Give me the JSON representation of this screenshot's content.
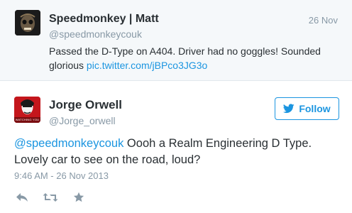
{
  "top_tweet": {
    "display_name": "Speedmonkey | Matt",
    "handle": "@speedmonkeycouk",
    "date": "26 Nov",
    "text": "Passed the D-Type on A404. Driver had no goggles!  Sounded glorious ",
    "link": "pic.twitter.com/jBPco3JG3o"
  },
  "main_tweet": {
    "display_name": "Jorge Orwell",
    "handle": "@Jorge_orwell",
    "mention": "@speedmonkeycouk",
    "text_after_mention": " Oooh  a Realm Engineering D Type. Lovely car to see on the road, loud?",
    "timestamp": "9:46 AM - 26 Nov 2013",
    "avatar_caption": "WATCHING YOU"
  },
  "follow_button": {
    "label": "Follow"
  },
  "actions": [
    "reply-icon",
    "retweet-icon",
    "favorite-icon"
  ],
  "colors": {
    "link": "#1b95e0",
    "muted": "#8899a6",
    "text": "#292f33",
    "top_bg": "#f5f8fa",
    "avatar_red": "#c4161c"
  }
}
